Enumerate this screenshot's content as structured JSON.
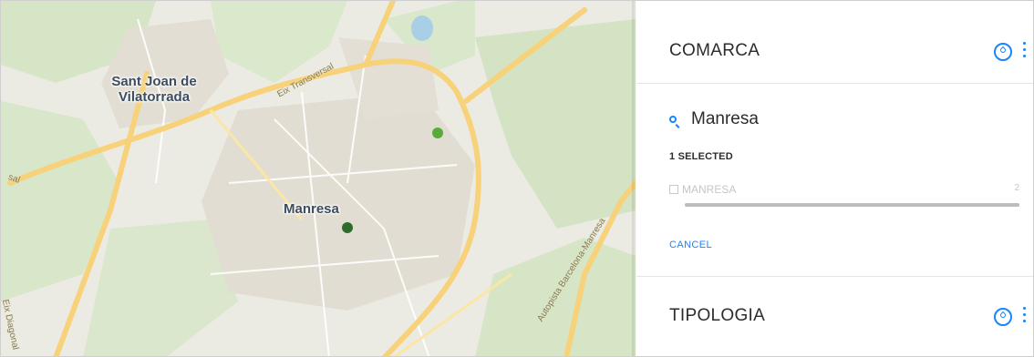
{
  "map": {
    "place_labels": [
      "Sant Joan de\nVilatorrada",
      "Manresa"
    ],
    "road_labels": [
      "Eix Transversal",
      "Autopista Barcelona-Manresa",
      "Eix Diagonal",
      "sal"
    ],
    "markers": [
      {
        "name": "marker-1",
        "color": "#5aaa3a"
      },
      {
        "name": "marker-2",
        "color": "#2f6b2a"
      }
    ]
  },
  "panel": {
    "sections": [
      {
        "title": "COMARCA",
        "icon": "drop-icon",
        "menu_icon": "kebab-menu-icon"
      },
      {
        "title": "TIPOLOGIA",
        "icon": "drop-icon",
        "menu_icon": "kebab-menu-icon"
      }
    ],
    "search": {
      "value": "Manresa",
      "icon": "search-icon"
    },
    "selected_count": "1 SELECTED",
    "options": [
      {
        "label": "MANRESA",
        "count": "2",
        "fraction": 1.0,
        "checked": false
      }
    ],
    "cancel_label": "CANCEL"
  },
  "colors": {
    "accent": "#1785fb",
    "map_land": "#ecebe3",
    "map_green": "#d3e3c4",
    "map_road": "#f7d27a"
  }
}
